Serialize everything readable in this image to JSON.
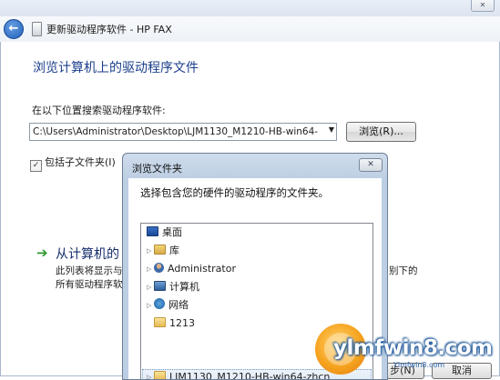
{
  "window": {
    "title": "更新驱动程序软件 - HP FAX",
    "heading": "浏览计算机上的驱动程序文件"
  },
  "search": {
    "label": "在以下位置搜索驱动程序软件:",
    "path_value": "C:\\Users\\Administrator\\Desktop\\LJM1130_M1210-HB-win64-",
    "browse_label": "浏览(R)...",
    "include_subfolders_label": "包括子文件夹(I)",
    "include_subfolders_checked": true
  },
  "pick_option": {
    "title": "从计算机的",
    "desc_line1": "此列表将显示与",
    "desc_line2": "所有驱动程序软",
    "desc_right_fragment": "别下的"
  },
  "bottom_buttons": {
    "next_partial": "步(N)",
    "cancel": "取消"
  },
  "browse_dialog": {
    "title": "浏览文件夹",
    "prompt": "选择包含您的硬件的驱动程序的文件夹。",
    "tree": [
      {
        "label": "桌面",
        "icon": "desktop-icon",
        "expandable": false
      },
      {
        "label": "库",
        "icon": "library-icon",
        "expandable": true
      },
      {
        "label": "Administrator",
        "icon": "user-folder-icon",
        "expandable": true
      },
      {
        "label": "计算机",
        "icon": "computer-icon",
        "expandable": true
      },
      {
        "label": "网络",
        "icon": "network-icon",
        "expandable": true
      },
      {
        "label": "1213",
        "icon": "folder-icon",
        "expandable": false
      },
      {
        "label": "LJM1130_M1210-HB-win64-zhcn",
        "icon": "folder-icon",
        "expandable": true,
        "selected": true
      }
    ]
  },
  "watermark": {
    "text": "ylmfwin8.com",
    "sub": "Ylmfwin8.com"
  },
  "colors": {
    "heading": "#1b3f8c",
    "link": "#152e6b",
    "dialog_frame": "#bccee3",
    "arrow_green": "#2f9a2f"
  }
}
